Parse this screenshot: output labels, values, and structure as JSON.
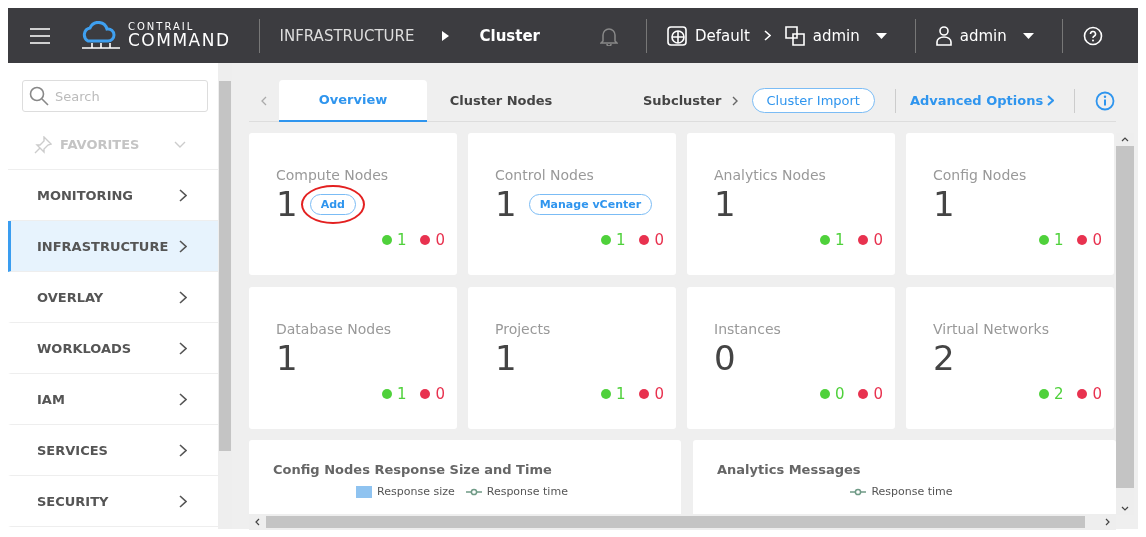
{
  "header": {
    "brand_top": "CONTRAIL",
    "brand_bottom": "COMMAND",
    "breadcrumb": [
      {
        "label": "INFRASTRUCTURE",
        "current": false
      },
      {
        "label": "Cluster",
        "current": true
      }
    ],
    "domain": "Default",
    "project": "admin",
    "user": "admin"
  },
  "sidebar": {
    "search": {
      "placeholder": "Search"
    },
    "favorites": "FAVORITES",
    "items": [
      {
        "label": "MONITORING",
        "selected": false
      },
      {
        "label": "INFRASTRUCTURE",
        "selected": true
      },
      {
        "label": "OVERLAY",
        "selected": false
      },
      {
        "label": "WORKLOADS",
        "selected": false
      },
      {
        "label": "IAM",
        "selected": false
      },
      {
        "label": "SERVICES",
        "selected": false
      },
      {
        "label": "SECURITY",
        "selected": false
      }
    ]
  },
  "tabs": [
    {
      "label": "Overview",
      "selected": true
    },
    {
      "label": "Cluster Nodes",
      "selected": false
    }
  ],
  "toolbar": {
    "subcluster": "Subcluster",
    "import": "Cluster Import",
    "advanced": "Advanced Options"
  },
  "cards": [
    {
      "title": "Compute Nodes",
      "count": "1",
      "action": {
        "label": "Add",
        "circled": true
      },
      "up": "1",
      "down": "0"
    },
    {
      "title": "Control Nodes",
      "count": "1",
      "action": {
        "label": "Manage vCenter",
        "circled": false
      },
      "up": "1",
      "down": "0"
    },
    {
      "title": "Analytics Nodes",
      "count": "1",
      "up": "1",
      "down": "0"
    },
    {
      "title": "Config Nodes",
      "count": "1",
      "up": "1",
      "down": "0"
    },
    {
      "title": "Database Nodes",
      "count": "1",
      "up": "1",
      "down": "0"
    },
    {
      "title": "Projects",
      "count": "1",
      "up": "1",
      "down": "0"
    },
    {
      "title": "Instances",
      "count": "0",
      "up": "0",
      "down": "0"
    },
    {
      "title": "Virtual Networks",
      "count": "2",
      "up": "2",
      "down": "0"
    }
  ],
  "panels": [
    {
      "title": "Config Nodes Response Size and Time",
      "legend": [
        {
          "kind": "bar",
          "label": "Response size",
          "color": "#8fc3f0"
        },
        {
          "kind": "line",
          "label": "Response time",
          "color": "#6f9a86"
        }
      ]
    },
    {
      "title": "Analytics Messages",
      "legend": [
        {
          "kind": "line",
          "label": "Response time",
          "color": "#6f9a86"
        }
      ]
    }
  ]
}
